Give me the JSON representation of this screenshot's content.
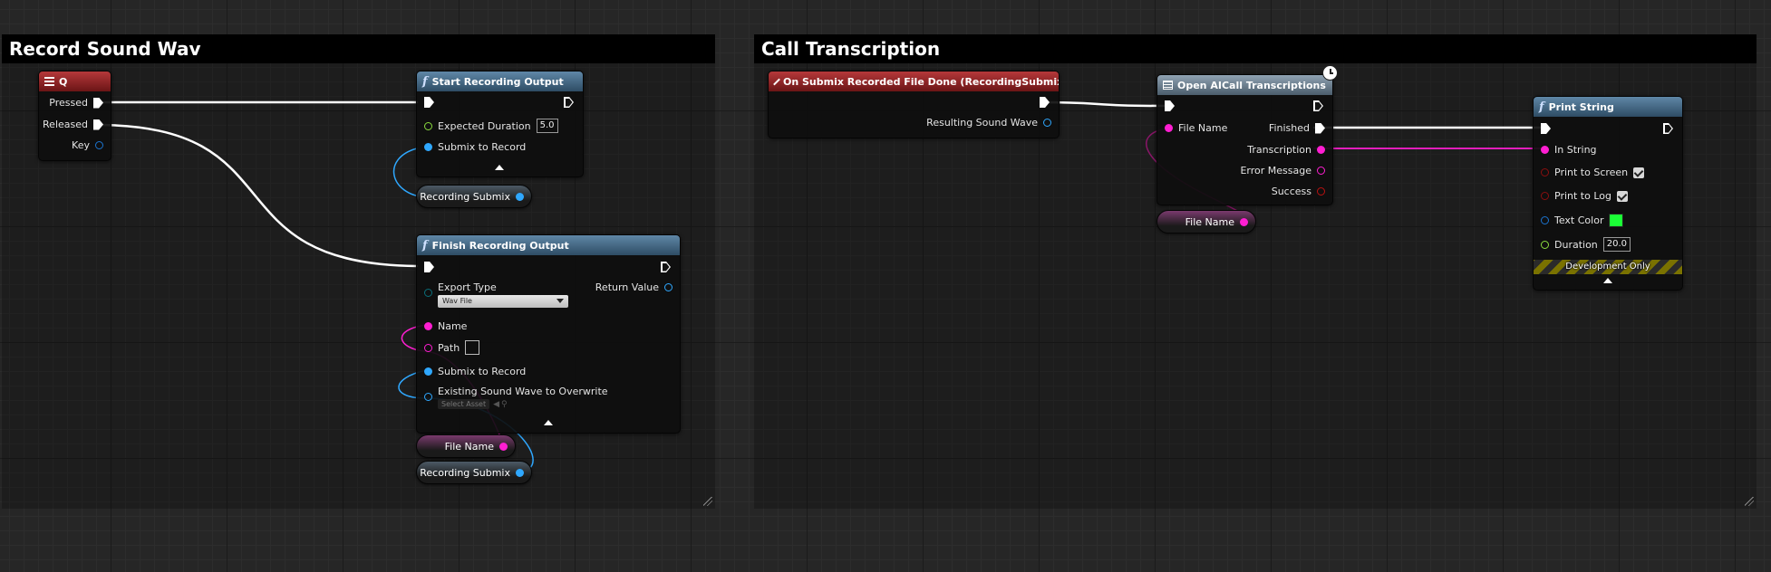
{
  "comments": {
    "record": {
      "title": "Record Sound Wav"
    },
    "transcription": {
      "title": "Call Transcription"
    }
  },
  "nodes": {
    "q_key": {
      "title": "Q",
      "pressed": "Pressed",
      "released": "Released",
      "key": "Key"
    },
    "start_recording": {
      "title": "Start Recording Output",
      "expected_duration_label": "Expected Duration",
      "expected_duration_value": "5.0",
      "submix_label": "Submix to Record"
    },
    "finish_recording": {
      "title": "Finish Recording Output",
      "export_type_label": "Export Type",
      "export_type_value": "Wav File",
      "return_value_label": "Return Value",
      "name_label": "Name",
      "path_label": "Path",
      "submix_label": "Submix to Record",
      "existing_label": "Existing Sound Wave to Overwrite",
      "select_asset": "Select Asset"
    },
    "on_submix": {
      "title": "On Submix Recorded File Done (RecordingSubmix)",
      "resulting_label": "Resulting Sound Wave"
    },
    "open_aicall": {
      "title": "Open AICall Transcriptions",
      "file_name_label": "File Name",
      "finished_label": "Finished",
      "transcription_label": "Transcription",
      "error_label": "Error Message",
      "success_label": "Success"
    },
    "print_string": {
      "title": "Print String",
      "in_string_label": "In String",
      "print_screen_label": "Print to Screen",
      "print_log_label": "Print to Log",
      "text_color_label": "Text Color",
      "duration_label": "Duration",
      "duration_value": "20.0",
      "dev_only": "Development Only"
    }
  },
  "variables": {
    "recording_submix_1": "Recording Submix",
    "file_name_1": "File Name",
    "recording_submix_2": "Recording Submix",
    "file_name_2": "File Name"
  },
  "colors": {
    "exec": "#ffffff",
    "object_pin": "#2fa8ff",
    "string_pin": "#ff1ed2",
    "float_pin": "#8bdc3e",
    "text_color_swatch": "#1bff36"
  }
}
